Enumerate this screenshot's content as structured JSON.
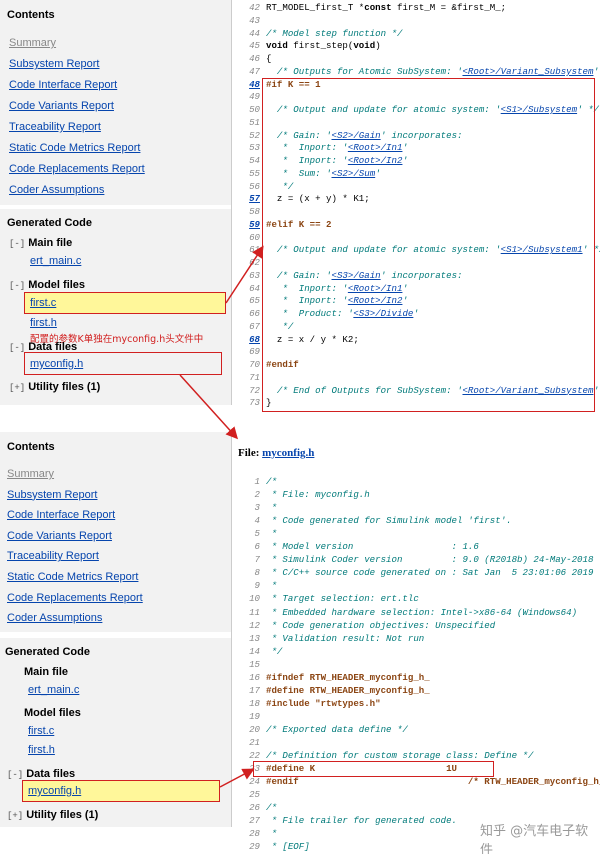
{
  "top_sidebar": {
    "contents_title": "Contents",
    "links": [
      "Summary",
      "Subsystem Report",
      "Code Interface Report",
      "Code Variants Report",
      "Traceability Report",
      "Static Code Metrics Report",
      "Code Replacements Report",
      "Coder Assumptions"
    ],
    "generated_code": "Generated Code",
    "main_file": "Main file",
    "main_toggle": "[-]",
    "ert_main": "ert_main.c",
    "model_files": "Model files",
    "model_toggle": "[-]",
    "first_c": "first.c",
    "first_h": "first.h",
    "data_files": "Data files",
    "data_toggle": "[-]",
    "myconfig": "myconfig.h",
    "utility_files": "Utility files (1)",
    "utility_toggle": "[+]"
  },
  "annotation": "配置的参数K单独在myconfig.h头文件中",
  "top_code": [
    {
      "n": "42",
      "t": "RT_MODEL_first_T *const first_M = &first_M_;",
      "c": "plain"
    },
    {
      "n": "43",
      "t": "",
      "c": "plain"
    },
    {
      "n": "44",
      "t": "/* Model step function */",
      "c": "cm"
    },
    {
      "n": "45",
      "t": "void first_step(void)",
      "c": "plain"
    },
    {
      "n": "46",
      "t": "{",
      "c": "plain"
    },
    {
      "n": "47",
      "t": "  /* Outputs for Atomic SubSystem: '<Root>/Variant_Subsystem' */",
      "c": "cm"
    },
    {
      "n": "48",
      "t": "#if K == 1",
      "c": "pp",
      "u": true
    },
    {
      "n": "49",
      "t": "",
      "c": "plain"
    },
    {
      "n": "50",
      "t": "  /* Output and update for atomic system: '<S1>/Subsystem' */",
      "c": "cm"
    },
    {
      "n": "51",
      "t": "",
      "c": "plain"
    },
    {
      "n": "52",
      "t": "  /* Gain: '<S2>/Gain' incorporates:",
      "c": "cm"
    },
    {
      "n": "53",
      "t": "   *  Inport: '<Root>/In1'",
      "c": "cm"
    },
    {
      "n": "54",
      "t": "   *  Inport: '<Root>/In2'",
      "c": "cm"
    },
    {
      "n": "55",
      "t": "   *  Sum: '<S2>/Sum'",
      "c": "cm"
    },
    {
      "n": "56",
      "t": "   */",
      "c": "cm"
    },
    {
      "n": "57",
      "t": "  z = (x + y) * K1;",
      "c": "plain",
      "u": true
    },
    {
      "n": "58",
      "t": "",
      "c": "plain"
    },
    {
      "n": "59",
      "t": "#elif K == 2",
      "c": "pp",
      "u": true
    },
    {
      "n": "60",
      "t": "",
      "c": "plain"
    },
    {
      "n": "61",
      "t": "  /* Output and update for atomic system: '<S1>/Subsystem1' */",
      "c": "cm"
    },
    {
      "n": "62",
      "t": "",
      "c": "plain"
    },
    {
      "n": "63",
      "t": "  /* Gain: '<S3>/Gain' incorporates:",
      "c": "cm"
    },
    {
      "n": "64",
      "t": "   *  Inport: '<Root>/In1'",
      "c": "cm"
    },
    {
      "n": "65",
      "t": "   *  Inport: '<Root>/In2'",
      "c": "cm"
    },
    {
      "n": "66",
      "t": "   *  Product: '<S3>/Divide'",
      "c": "cm"
    },
    {
      "n": "67",
      "t": "   */",
      "c": "cm"
    },
    {
      "n": "68",
      "t": "  z = x / y * K2;",
      "c": "plain",
      "u": true
    },
    {
      "n": "69",
      "t": "",
      "c": "plain"
    },
    {
      "n": "70",
      "t": "#endif",
      "c": "pp"
    },
    {
      "n": "71",
      "t": "",
      "c": "plain"
    },
    {
      "n": "72",
      "t": "  /* End of Outputs for SubSystem: '<Root>/Variant_Subsystem' */",
      "c": "cm"
    },
    {
      "n": "73",
      "t": "}",
      "c": "plain"
    }
  ],
  "bottom_sidebar": {
    "contents_title": "Contents",
    "links": [
      "Summary",
      "Subsystem Report",
      "Code Interface Report",
      "Code Variants Report",
      "Traceability Report",
      "Static Code Metrics Report",
      "Code Replacements Report",
      "Coder Assumptions"
    ],
    "generated_code": "Generated Code",
    "main_file": "Main file",
    "main_toggle": "[-]",
    "ert_main": "ert_main.c",
    "model_files": "Model files",
    "model_toggle": "[-]",
    "first_c": "first.c",
    "first_h": "first.h",
    "data_files": "Data files",
    "data_toggle": "[-]",
    "myconfig": "myconfig.h",
    "utility_files": "Utility files (1)",
    "utility_toggle": "[+]"
  },
  "file_header": {
    "label": "File: ",
    "name": "myconfig.h"
  },
  "bottom_code": [
    {
      "n": "1",
      "t": "/*",
      "c": "cm"
    },
    {
      "n": "2",
      "t": " * File: myconfig.h",
      "c": "cm"
    },
    {
      "n": "3",
      "t": " *",
      "c": "cm"
    },
    {
      "n": "4",
      "t": " * Code generated for Simulink model 'first'.",
      "c": "cm"
    },
    {
      "n": "5",
      "t": " *",
      "c": "cm"
    },
    {
      "n": "6",
      "t": " * Model version                  : 1.6",
      "c": "cm"
    },
    {
      "n": "7",
      "t": " * Simulink Coder version         : 9.0 (R2018b) 24-May-2018",
      "c": "cm"
    },
    {
      "n": "8",
      "t": " * C/C++ source code generated on : Sat Jan  5 23:01:06 2019",
      "c": "cm"
    },
    {
      "n": "9",
      "t": " *",
      "c": "cm"
    },
    {
      "n": "10",
      "t": " * Target selection: ert.tlc",
      "c": "cm"
    },
    {
      "n": "11",
      "t": " * Embedded hardware selection: Intel->x86-64 (Windows64)",
      "c": "cm"
    },
    {
      "n": "12",
      "t": " * Code generation objectives: Unspecified",
      "c": "cm"
    },
    {
      "n": "13",
      "t": " * Validation result: Not run",
      "c": "cm"
    },
    {
      "n": "14",
      "t": " */",
      "c": "cm"
    },
    {
      "n": "15",
      "t": "",
      "c": "plain"
    },
    {
      "n": "16",
      "t": "#ifndef RTW_HEADER_myconfig_h_",
      "c": "pp"
    },
    {
      "n": "17",
      "t": "#define RTW_HEADER_myconfig_h_",
      "c": "pp"
    },
    {
      "n": "18",
      "t": "#include \"rtwtypes.h\"",
      "c": "pp"
    },
    {
      "n": "19",
      "t": "",
      "c": "plain"
    },
    {
      "n": "20",
      "t": "/* Exported data define */",
      "c": "cm"
    },
    {
      "n": "21",
      "t": "",
      "c": "plain"
    },
    {
      "n": "22",
      "t": "/* Definition for custom storage class: Define */",
      "c": "cm"
    },
    {
      "n": "23",
      "t": "#define K                        1U",
      "c": "pp"
    },
    {
      "n": "24",
      "t": "#endif                               /* RTW_HEADER_myconfig_h_ */",
      "c": "pp"
    },
    {
      "n": "25",
      "t": "",
      "c": "plain"
    },
    {
      "n": "26",
      "t": "/*",
      "c": "cm"
    },
    {
      "n": "27",
      "t": " * File trailer for generated code.",
      "c": "cm"
    },
    {
      "n": "28",
      "t": " *",
      "c": "cm"
    },
    {
      "n": "29",
      "t": " * [EOF]",
      "c": "cm"
    }
  ],
  "watermark": "知乎 @汽车电子软件",
  "colors": {
    "highlight": "#d12020",
    "yellow": "#fff79a",
    "link": "#0645ad",
    "comment": "#007a7a"
  }
}
